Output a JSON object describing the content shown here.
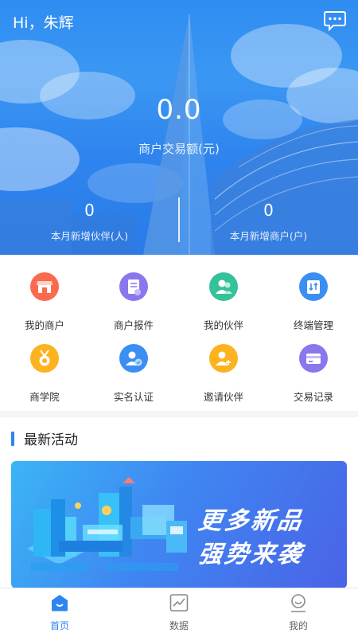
{
  "header": {
    "greeting": "Hi，朱辉",
    "message_icon": "chat-bubble-icon",
    "transaction_amount": "0.0",
    "transaction_label": "商户交易额(元)",
    "stats": [
      {
        "value": "0",
        "label": "本月新增伙伴(人)"
      },
      {
        "value": "0",
        "label": "本月新增商户(户)"
      }
    ]
  },
  "menu": {
    "items": [
      {
        "label": "我的商户",
        "icon": "shop-icon",
        "color": "#fb6a4f"
      },
      {
        "label": "商户报件",
        "icon": "document-icon",
        "color": "#8a77ee"
      },
      {
        "label": "我的伙伴",
        "icon": "partners-icon",
        "color": "#35c29a"
      },
      {
        "label": "终端管理",
        "icon": "terminal-icon",
        "color": "#3b8ff3"
      },
      {
        "label": "商学院",
        "icon": "medal-icon",
        "color": "#fdb21f"
      },
      {
        "label": "实名认证",
        "icon": "verified-user-icon",
        "color": "#3b8ff3"
      },
      {
        "label": "邀请伙伴",
        "icon": "invite-user-icon",
        "color": "#fdb21f"
      },
      {
        "label": "交易记录",
        "icon": "card-icon",
        "color": "#8a77ee"
      }
    ]
  },
  "activities": {
    "title": "最新活动",
    "banner_line1": "更多新品",
    "banner_line2": "强势来袭"
  },
  "bottom_nav": {
    "items": [
      {
        "label": "首页",
        "icon": "home-icon",
        "active": true
      },
      {
        "label": "数据",
        "icon": "chart-icon",
        "active": false
      },
      {
        "label": "我的",
        "icon": "profile-icon",
        "active": false
      }
    ],
    "active_color": "#2d86f0"
  }
}
